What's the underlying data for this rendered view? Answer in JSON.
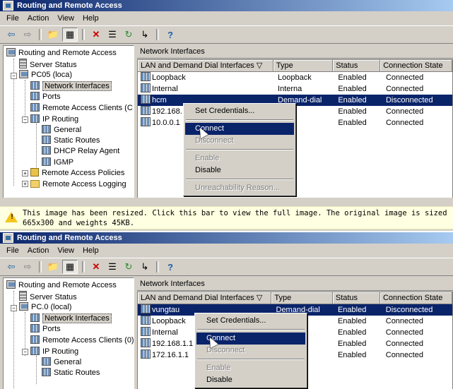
{
  "window1": {
    "title": "Routing and Remote Access",
    "menu": [
      "File",
      "Action",
      "View",
      "Help"
    ],
    "toolbar_icons": [
      "back-icon",
      "forward-icon",
      "up-folder-icon",
      "show-hide-tree-icon",
      "delete-icon",
      "properties-icon",
      "refresh-icon",
      "export-list-icon",
      "help-icon"
    ],
    "tree": [
      {
        "label": "Routing and Remote Access",
        "icon": "router-icon"
      },
      {
        "label": "Server Status",
        "icon": "server-icon"
      },
      {
        "label": "PC05 (loca)",
        "icon": "computer-icon"
      },
      {
        "label": "Network Interfaces",
        "icon": "network-icon",
        "selected": true
      },
      {
        "label": "Ports",
        "icon": "network-icon"
      },
      {
        "label": "Remote Access Clients (C",
        "icon": "network-icon"
      },
      {
        "label": "IP Routing",
        "icon": "network-icon"
      },
      {
        "label": "General",
        "icon": "network-icon"
      },
      {
        "label": "Static Routes",
        "icon": "network-icon"
      },
      {
        "label": "DHCP Relay Agent",
        "icon": "network-icon"
      },
      {
        "label": "IGMP",
        "icon": "network-icon"
      },
      {
        "label": "Remote Access Policies",
        "icon": "policy-icon"
      },
      {
        "label": "Remote Access Logging",
        "icon": "folder-icon"
      }
    ],
    "pane_title": "Network Interfaces",
    "columns": [
      "LAN and Demand Dial Interfaces",
      "Type",
      "Status",
      "Connection State"
    ],
    "rows": [
      {
        "name": "Loopback",
        "type": "Loopback",
        "status": "Enabled",
        "state": "Connected"
      },
      {
        "name": "Internal",
        "type": "Interna",
        "status": "Enabled",
        "state": "Connected"
      },
      {
        "name": "hcm",
        "type": "Demand-dial",
        "status": "Enabled",
        "state": "Disconnected",
        "selected": true
      },
      {
        "name": "192.168.",
        "type": "cated",
        "status": "Enabled",
        "state": "Connected"
      },
      {
        "name": "10.0.0.1",
        "type": "cated",
        "status": "Enabled",
        "state": "Connected"
      }
    ],
    "context_menu": [
      {
        "label": "Set Credentials...",
        "state": "normal"
      },
      {
        "sep": true
      },
      {
        "label": "Connect",
        "state": "highlighted"
      },
      {
        "label": "Disconnect",
        "state": "disabled"
      },
      {
        "sep": true
      },
      {
        "label": "Enable",
        "state": "disabled"
      },
      {
        "label": "Disable",
        "state": "normal"
      },
      {
        "sep": true
      },
      {
        "label": "Unreachability Reason...",
        "state": "disabled"
      }
    ]
  },
  "notice": {
    "text": "This image has been resized. Click this bar to view the full image. The original image is sized 665x300 and weights 45KB.",
    "icon": "warning-icon"
  },
  "window2": {
    "title": "Routing and Remote Access",
    "menu": [
      "File",
      "Action",
      "View",
      "Help"
    ],
    "toolbar_icons": [
      "back-icon",
      "forward-icon",
      "up-folder-icon",
      "show-hide-tree-icon",
      "delete-icon",
      "properties-icon",
      "refresh-icon",
      "export-list-icon",
      "help-icon"
    ],
    "tree": [
      {
        "label": "Routing and Remote Access",
        "icon": "router-icon"
      },
      {
        "label": "Server Status",
        "icon": "server-icon"
      },
      {
        "label": "PC.0 (local)",
        "icon": "computer-icon"
      },
      {
        "label": "Network Interfaces",
        "icon": "network-icon",
        "selected": true
      },
      {
        "label": "Ports",
        "icon": "network-icon"
      },
      {
        "label": "Remote Access Clients (0)",
        "icon": "network-icon"
      },
      {
        "label": "IP Routing",
        "icon": "network-icon"
      },
      {
        "label": "General",
        "icon": "network-icon"
      },
      {
        "label": "Static Routes",
        "icon": "network-icon"
      }
    ],
    "pane_title": "Network Interfaces",
    "columns": [
      "LAN and Demand Dial Interfaces",
      "Type",
      "Status",
      "Connection State"
    ],
    "rows": [
      {
        "name": "vungtau",
        "type": "Demand-dial",
        "status": "Enabled",
        "state": "Disconnected",
        "selected": true
      },
      {
        "name": "Loopback",
        "type": "ck",
        "status": "Enabled",
        "state": "Connected"
      },
      {
        "name": "Internal",
        "type": "",
        "status": "Enabled",
        "state": "Connected"
      },
      {
        "name": "192.168.1.1",
        "type": "ed",
        "status": "Enabled",
        "state": "Connected"
      },
      {
        "name": "172.16.1.1",
        "type": "ed",
        "status": "Enabled",
        "state": "Connected"
      }
    ],
    "context_menu": [
      {
        "label": "Set Credentials...",
        "state": "normal"
      },
      {
        "sep": true
      },
      {
        "label": "Connect",
        "state": "highlighted"
      },
      {
        "label": "Disconnect",
        "state": "disabled"
      },
      {
        "sep": true
      },
      {
        "label": "Enable",
        "state": "disabled"
      },
      {
        "label": "Disable",
        "state": "normal"
      }
    ]
  }
}
